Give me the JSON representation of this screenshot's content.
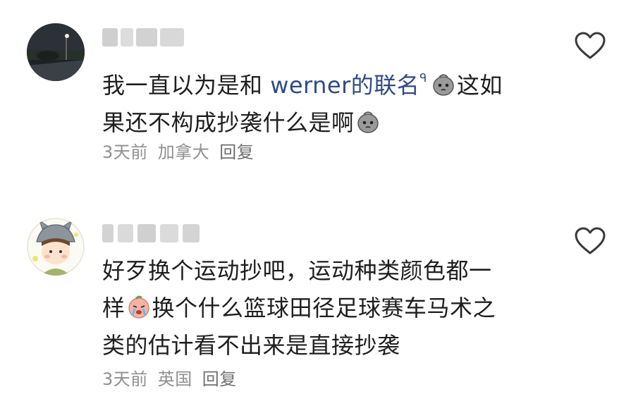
{
  "comments": [
    {
      "text_parts": [
        "我一直以为是和 ",
        "werner",
        "的联名",
        "ᑫ",
        "这如",
        "果还不构成抄袭什么是啊"
      ],
      "time": "3天前",
      "location": "加拿大",
      "reply_label": "回复",
      "avatar_icon": "night-road-photo-avatar",
      "like_icon": "heart-outline-icon"
    },
    {
      "text_parts": [
        "好歹换个运动抄吧，运动种类颜色都一",
        "样",
        "换个什么篮球田径足球赛车马术之",
        "类的估计看不出来是直接抄袭"
      ],
      "time": "3天前",
      "location": "英国",
      "reply_label": "回复",
      "avatar_icon": "cartoon-totoro-hat-avatar",
      "like_icon": "heart-outline-icon"
    }
  ],
  "colors": {
    "mention": "#2f4a86",
    "meta": "#8f8f8f",
    "heart": "#3a3a3a"
  }
}
